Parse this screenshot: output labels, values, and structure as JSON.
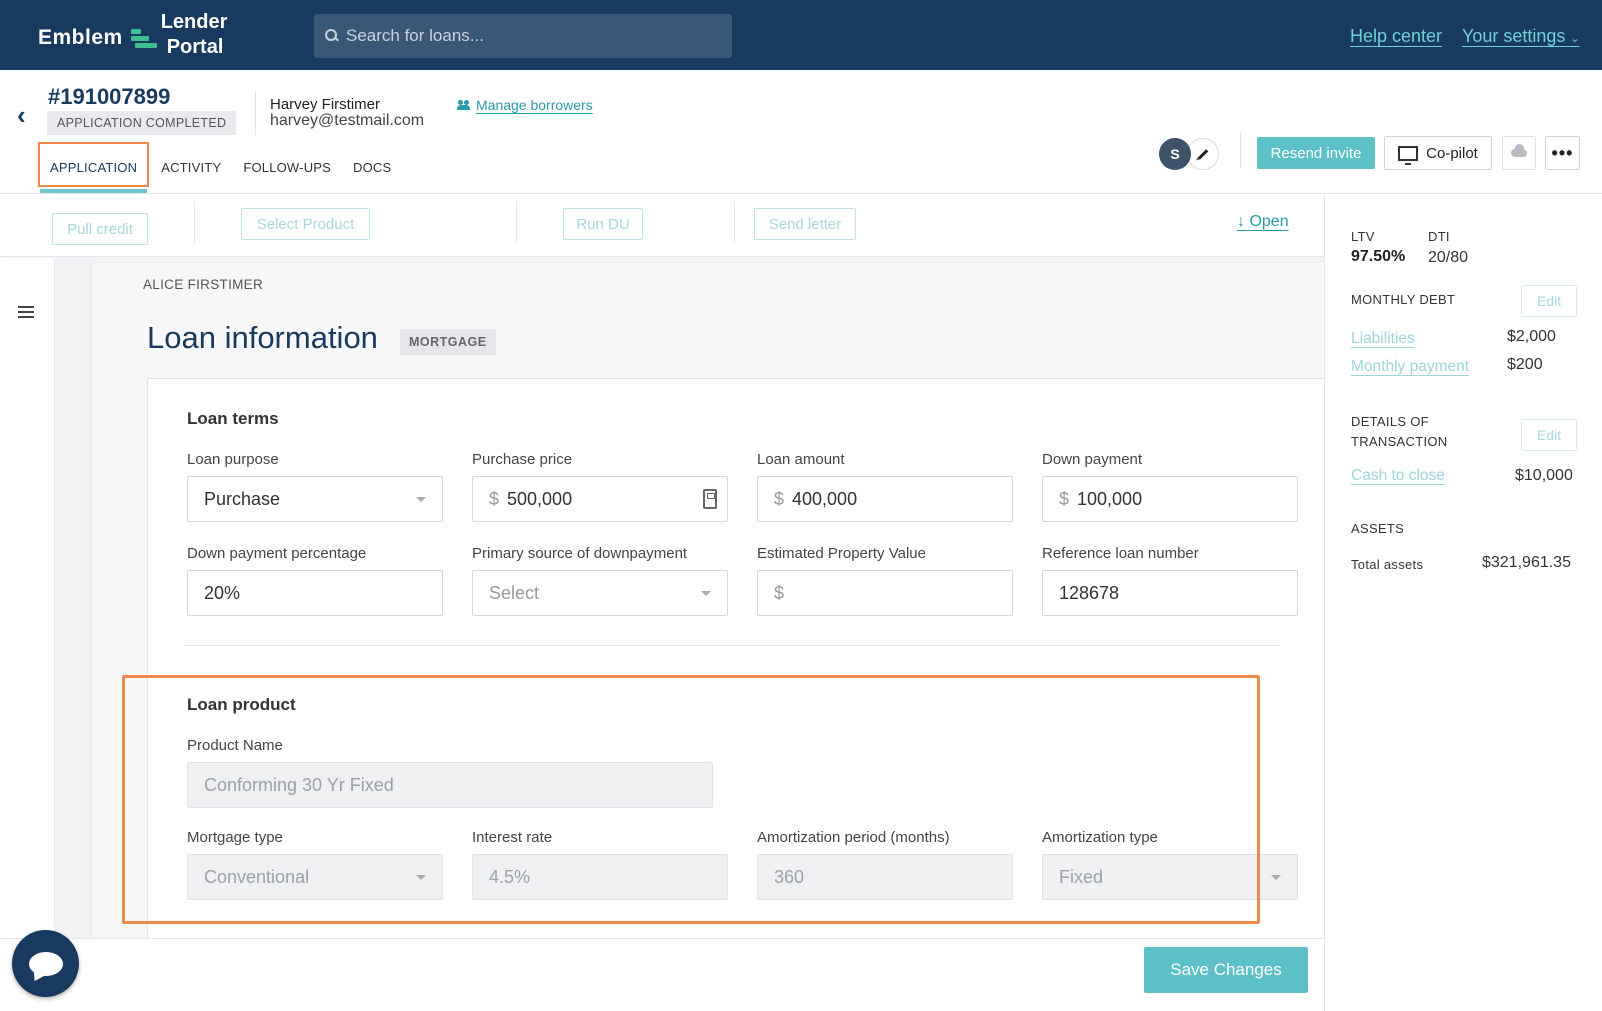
{
  "brand": {
    "name": "Emblem",
    "portal_line1": "Lender",
    "portal_line2": "Portal"
  },
  "search": {
    "placeholder": "Search for loans..."
  },
  "nav": {
    "help": "Help center",
    "settings": "Your settings"
  },
  "loan": {
    "number": "#191007899",
    "status": "APPLICATION COMPLETED",
    "borrower_name": "Harvey Firstimer",
    "borrower_email": "harvey@testmail.com",
    "manage_borrowers": "Manage borrowers"
  },
  "tabs": [
    "APPLICATION",
    "ACTIVITY",
    "FOLLOW-UPS",
    "DOCS"
  ],
  "header_actions": {
    "avatar_initial": "S",
    "resend": "Resend invite",
    "copilot": "Co-pilot",
    "more": "•••"
  },
  "action_bar": {
    "pull_credit": "Pull credit",
    "select_product": "Select Product",
    "run_du": "Run DU",
    "send_letter": "Send letter",
    "open": "↓ Open"
  },
  "main": {
    "applicant": "ALICE FIRSTIMER",
    "title": "Loan information",
    "badge": "MORTGAGE",
    "loan_terms": {
      "title": "Loan terms",
      "loan_purpose": {
        "label": "Loan purpose",
        "value": "Purchase"
      },
      "purchase_price": {
        "label": "Purchase price",
        "prefix": "$",
        "value": "500,000"
      },
      "loan_amount": {
        "label": "Loan amount",
        "prefix": "$",
        "value": "400,000"
      },
      "down_payment": {
        "label": "Down payment",
        "prefix": "$",
        "value": "100,000"
      },
      "down_payment_pct": {
        "label": "Down payment percentage",
        "value": "20%"
      },
      "primary_source": {
        "label": "Primary source of downpayment",
        "placeholder": "Select"
      },
      "est_property_value": {
        "label": "Estimated Property Value",
        "prefix": "$",
        "value": ""
      },
      "reference_number": {
        "label": "Reference loan number",
        "value": "128678"
      }
    },
    "loan_product": {
      "title": "Loan product",
      "product_name": {
        "label": "Product Name",
        "value": "Conforming 30 Yr Fixed"
      },
      "mortgage_type": {
        "label": "Mortgage type",
        "value": "Conventional"
      },
      "interest_rate": {
        "label": "Interest rate",
        "value": "4.5%"
      },
      "amortization_period": {
        "label": "Amortization period (months)",
        "value": "360"
      },
      "amortization_type": {
        "label": "Amortization type",
        "value": "Fixed"
      }
    }
  },
  "save": "Save Changes",
  "side": {
    "ltv_label": "LTV",
    "ltv_value": "97.50%",
    "dti_label": "DTI",
    "dti_value": "20/80",
    "monthly_debt": {
      "title": "MONTHLY DEBT",
      "edit": "Edit",
      "liabilities_label": "Liabilities",
      "liabilities_value": "$2,000",
      "monthly_payment_label": "Monthly payment",
      "monthly_payment_value": "$200"
    },
    "transaction": {
      "title_line1": "DETAILS OF",
      "title_line2": "TRANSACTION",
      "edit": "Edit",
      "cash_label": "Cash to close",
      "cash_value": "$10,000"
    },
    "assets": {
      "title": "ASSETS",
      "total_label": "Total assets",
      "total_value": "$321,961.35"
    }
  }
}
